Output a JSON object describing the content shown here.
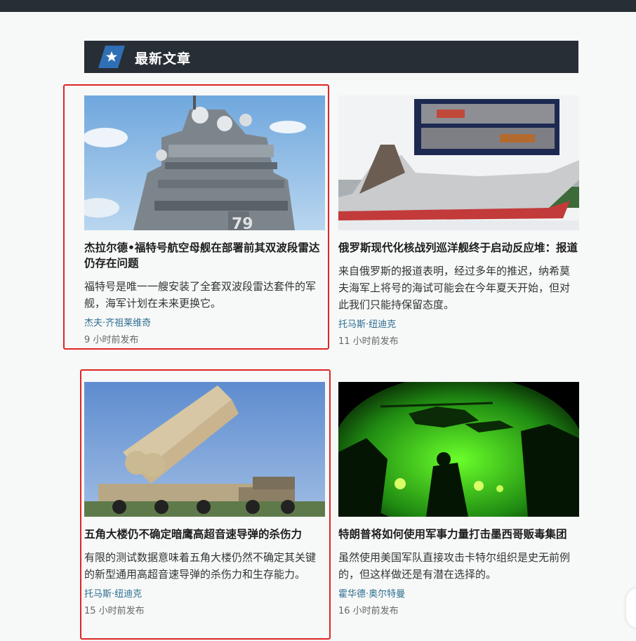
{
  "section": {
    "title": "最新文章",
    "star_icon": "star-icon"
  },
  "articles": [
    {
      "title": "杰拉尔德•福特号航空母舰在部署前其双波段雷达仍存在问题",
      "excerpt": "福特号是唯一一艘安装了全套双波段雷达套件的军舰，海军计划在未来更换它。",
      "author": "杰夫·齐祖莱维奇",
      "time": "9 小时前发布",
      "image": "aircraft-carrier-island-image",
      "hull_number": "79"
    },
    {
      "title": "俄罗斯现代化核战列巡洋舰终于启动反应堆：报道",
      "excerpt": "来自俄罗斯的报道表明，经过多年的推迟，纳希莫夫海军上将号的海试可能会在今年夏天开始，但对此我们只能持保留态度。",
      "author": "托马斯·纽迪克",
      "time": "11 小时前发布",
      "image": "battlecruiser-image"
    },
    {
      "title": "五角大楼仍不确定暗鹰高超音速导弹的杀伤力",
      "excerpt": "有限的测试数据意味着五角大楼仍然不确定其关键的新型通用高超音速导弹的杀伤力和生存能力。",
      "author": "托马斯·纽迪克",
      "time": "15 小时前发布",
      "image": "hypersonic-missile-launcher-image"
    },
    {
      "title": "特朗普将如何使用军事力量打击墨西哥贩毒集团",
      "excerpt": "虽然使用美国军队直接攻击卡特尔组织是史无前例的，但这样做还是有潜在选择的。",
      "author": "霍华德·奥尔特曼",
      "time": "16 小时前发布",
      "image": "night-vision-helicopter-image"
    }
  ],
  "colors": {
    "header_bg": "#282e35",
    "author_link": "#2c6e8f",
    "highlight": "#e02424",
    "badge_blue": "#2f6fb5"
  }
}
